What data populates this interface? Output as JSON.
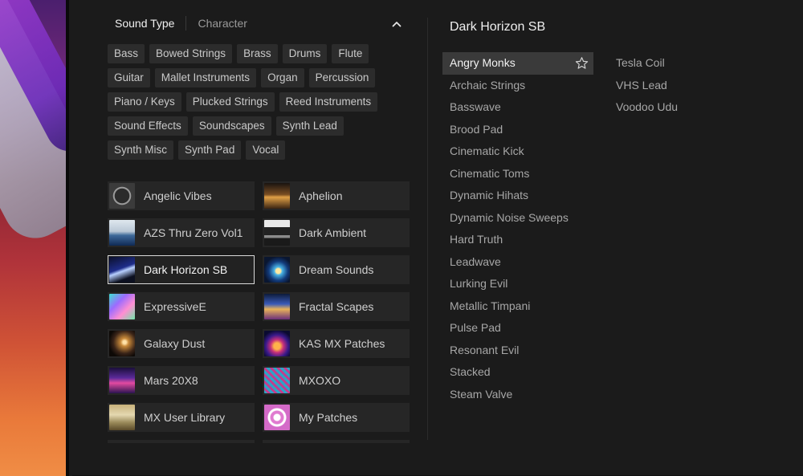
{
  "header": {
    "tabs": [
      {
        "label": "Sound Type",
        "active": true
      },
      {
        "label": "Character",
        "active": false
      }
    ]
  },
  "sound_types": [
    [
      "Bass",
      "Bowed Strings",
      "Brass",
      "Drums",
      "Flute"
    ],
    [
      "Guitar",
      "Mallet Instruments",
      "Organ",
      "Percussion"
    ],
    [
      "Piano / Keys",
      "Plucked Strings",
      "Reed Instruments"
    ],
    [
      "Sound Effects",
      "Soundscapes",
      "Synth Lead"
    ],
    [
      "Synth Misc",
      "Synth Pad",
      "Vocal"
    ]
  ],
  "libraries": [
    {
      "name": "Angelic Vibes",
      "art": "angelic"
    },
    {
      "name": "Aphelion",
      "art": "aphelion"
    },
    {
      "name": "AZS Thru Zero Vol1",
      "art": "azs"
    },
    {
      "name": "Dark Ambient",
      "art": "darkambient"
    },
    {
      "name": "Dark Horizon SB",
      "art": "darkhorizon",
      "selected": true
    },
    {
      "name": "Dream Sounds",
      "art": "dream"
    },
    {
      "name": "ExpressiveE",
      "art": "expressive"
    },
    {
      "name": "Fractal Scapes",
      "art": "fractal"
    },
    {
      "name": "Galaxy Dust",
      "art": "galaxy"
    },
    {
      "name": "KAS MX Patches",
      "art": "kas"
    },
    {
      "name": "Mars 20X8",
      "art": "mars"
    },
    {
      "name": "MXOXO",
      "art": "mxoxo"
    },
    {
      "name": "MX User Library",
      "art": "userlib"
    },
    {
      "name": "My Patches",
      "art": "mypatches"
    }
  ],
  "selected_library": {
    "title": "Dark Horizon SB"
  },
  "presets_left": [
    "Angry Monks",
    "Archaic Strings",
    "Basswave",
    "Brood Pad",
    "Cinematic Kick",
    "Cinematic Toms",
    "Dynamic Hihats",
    "Dynamic Noise Sweeps",
    "Hard Truth",
    "Leadwave",
    "Lurking Evil",
    "Metallic Timpani",
    "Pulse Pad",
    "Resonant Evil",
    "Stacked",
    "Steam Valve"
  ],
  "presets_right": [
    "Tesla Coil",
    "VHS Lead",
    "Voodoo Udu"
  ],
  "active_preset": "Angry Monks",
  "icons": {
    "collapse": "chevron-up-icon",
    "favorite": "star-outline-icon"
  },
  "colors": {
    "panel_bg": "#1b1b1b",
    "chip_bg": "#2c2c2c",
    "card_bg": "#262626",
    "active_row_bg": "#3a3a3a",
    "text_primary": "#f0f0f0",
    "text_secondary": "#a7a7a7"
  }
}
